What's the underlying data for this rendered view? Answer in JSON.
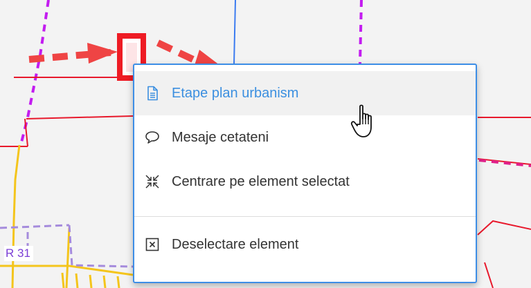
{
  "context_menu": {
    "items": [
      {
        "label": "Etape plan urbanism",
        "icon": "document-icon",
        "active": true
      },
      {
        "label": "Mesaje cetateni",
        "icon": "speech-bubble-icon",
        "active": false
      },
      {
        "label": "Centrare pe element selectat",
        "icon": "center-arrows-icon",
        "active": false
      },
      {
        "label": "Deselectare element",
        "icon": "close-box-icon",
        "active": false
      }
    ]
  },
  "map": {
    "road_label": "R 31"
  },
  "colors": {
    "accent": "#3b8fe0",
    "menu_border": "#3d8ee6",
    "arrow": "#ef4444",
    "selection": "#ee1b24",
    "boundary_red": "#e8192c",
    "boundary_purple": "#c31cf0",
    "road_yellow": "#f4c51c",
    "road_purple_dashed": "#a58bdc",
    "line_blue": "#3b7bf0",
    "line_pink_dashed": "#e0208a"
  }
}
